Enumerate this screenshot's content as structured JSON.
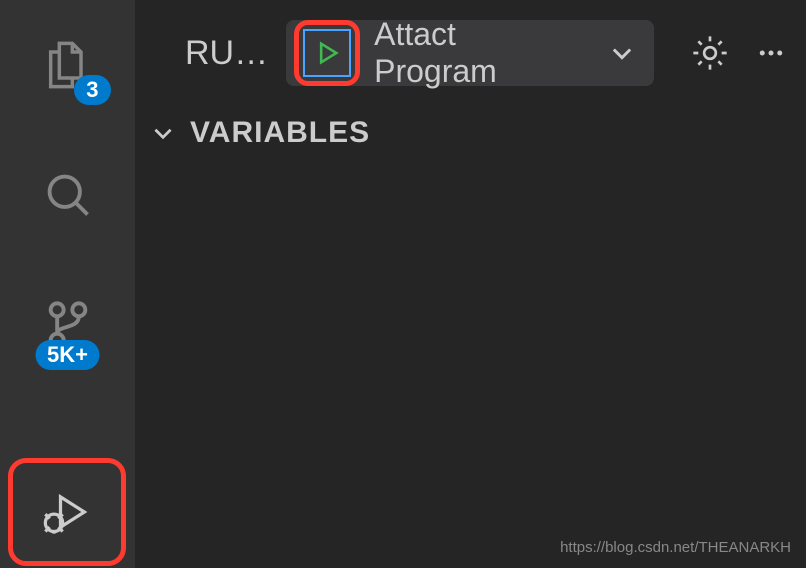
{
  "activityBar": {
    "explorerBadge": "3",
    "scmBadge": "5K+"
  },
  "header": {
    "runLabel": "RU…",
    "configName": "Attact Program"
  },
  "sections": {
    "variablesLabel": "VARIABLES"
  },
  "watermark": "https://blog.csdn.net/THEANARKH"
}
